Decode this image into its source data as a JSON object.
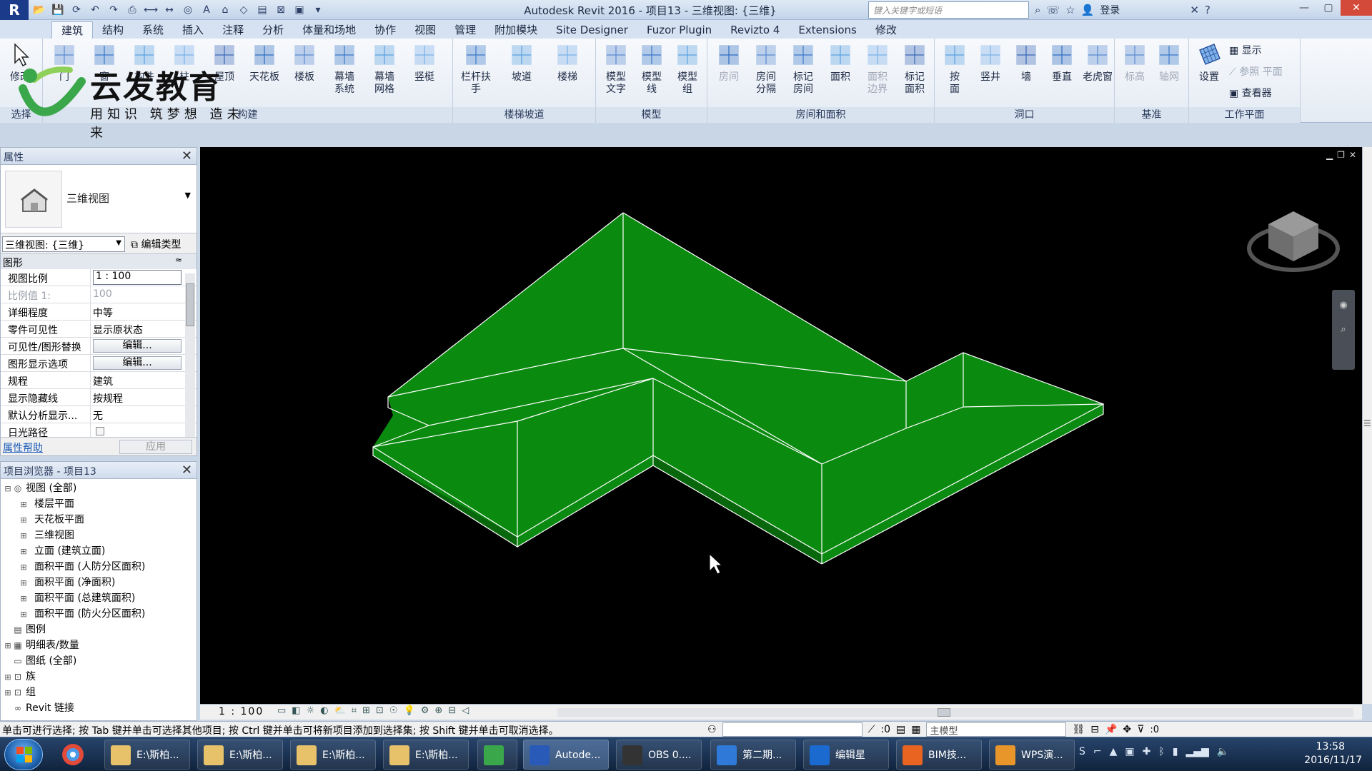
{
  "titlebar": {
    "app_logo": "R",
    "title": "Autodesk Revit 2016 -    项目13 - 三维视图: {三维}",
    "search_placeholder": "键入关键字或短语",
    "login": "登录"
  },
  "brand": {
    "title": "云发教育",
    "slogan": "用知识 筑梦想 造未来"
  },
  "ribbon_tabs": [
    {
      "label": "建筑",
      "active": true
    },
    {
      "label": "结构"
    },
    {
      "label": "系统"
    },
    {
      "label": "插入"
    },
    {
      "label": "注释"
    },
    {
      "label": "分析"
    },
    {
      "label": "体量和场地"
    },
    {
      "label": "协作"
    },
    {
      "label": "视图"
    },
    {
      "label": "管理"
    },
    {
      "label": "附加模块"
    },
    {
      "label": "Site Designer"
    },
    {
      "label": "Fuzor Plugin"
    },
    {
      "label": "Revizto 4"
    },
    {
      "label": "Extensions"
    },
    {
      "label": "修改"
    }
  ],
  "ribbon": {
    "select": {
      "modify": "修改",
      "title": "选择"
    },
    "build": {
      "title": "构建",
      "buttons": [
        "门",
        "窗",
        "构件",
        "柱",
        "屋顶",
        "天花板",
        "楼板",
        "幕墙\n系统",
        "幕墙\n网格",
        "竖梃"
      ]
    },
    "stairs": {
      "title": "楼梯坡道",
      "buttons": [
        "栏杆扶手",
        "坡道",
        "楼梯"
      ]
    },
    "model": {
      "title": "模型",
      "buttons": [
        "模型\n文字",
        "模型\n线",
        "模型\n组"
      ]
    },
    "room": {
      "title": "房间和面积",
      "buttons": [
        "房间",
        "房间\n分隔",
        "标记\n房间",
        "面积",
        "面积\n边界",
        "标记\n面积"
      ]
    },
    "opening": {
      "title": "洞口",
      "buttons": [
        "按\n面",
        "竖井",
        "墙",
        "垂直",
        "老虎窗"
      ]
    },
    "datum": {
      "title": "基准",
      "buttons": [
        "标高",
        "轴网"
      ]
    },
    "workplane": {
      "title": "工作平面",
      "set": "设置",
      "show": "显示",
      "ref_plane": "参照 平面",
      "viewer": "查看器"
    }
  },
  "properties": {
    "title": "属性",
    "type_name": "三维视图",
    "view_selector": "三维视图: {三维}",
    "edit_type": "编辑类型",
    "category": "图形",
    "rows": [
      {
        "key": "视图比例",
        "value": "1 : 100",
        "kind": "input"
      },
      {
        "key": "比例值 1:",
        "value": "100",
        "kind": "dim"
      },
      {
        "key": "详细程度",
        "value": "中等"
      },
      {
        "key": "零件可见性",
        "value": "显示原状态"
      },
      {
        "key": "可见性/图形替换",
        "value": "编辑...",
        "kind": "button"
      },
      {
        "key": "图形显示选项",
        "value": "编辑...",
        "kind": "button"
      },
      {
        "key": "规程",
        "value": "建筑"
      },
      {
        "key": "显示隐藏线",
        "value": "按规程"
      },
      {
        "key": "默认分析显示...",
        "value": "无"
      },
      {
        "key": "日光路径",
        "value": "",
        "kind": "checkbox"
      }
    ],
    "help": "属性帮助",
    "apply": "应用"
  },
  "browser": {
    "title": "项目浏览器 - 项目13",
    "nodes": [
      {
        "label": "视图 (全部)",
        "level": 0,
        "exp": "⊟",
        "icon": "◎"
      },
      {
        "label": "楼层平面",
        "level": 1,
        "exp": "⊞"
      },
      {
        "label": "天花板平面",
        "level": 1,
        "exp": "⊞"
      },
      {
        "label": "三维视图",
        "level": 1,
        "exp": "⊞"
      },
      {
        "label": "立面 (建筑立面)",
        "level": 1,
        "exp": "⊞"
      },
      {
        "label": "面积平面 (人防分区面积)",
        "level": 1,
        "exp": "⊞"
      },
      {
        "label": "面积平面 (净面积)",
        "level": 1,
        "exp": "⊞"
      },
      {
        "label": "面积平面 (总建筑面积)",
        "level": 1,
        "exp": "⊞"
      },
      {
        "label": "面积平面 (防火分区面积)",
        "level": 1,
        "exp": "⊞"
      },
      {
        "label": "图例",
        "level": 0,
        "exp": "",
        "icon": "▤"
      },
      {
        "label": "明细表/数量",
        "level": 0,
        "exp": "⊞",
        "icon": "▦"
      },
      {
        "label": "图纸 (全部)",
        "level": 0,
        "exp": "",
        "icon": "▭"
      },
      {
        "label": "族",
        "level": 0,
        "exp": "⊞",
        "icon": "⊡"
      },
      {
        "label": "组",
        "level": 0,
        "exp": "⊞",
        "icon": "⊡"
      },
      {
        "label": "Revit 链接",
        "level": 0,
        "exp": "",
        "icon": "∞"
      }
    ]
  },
  "viewport": {
    "roof_color": "#0b8a10",
    "edge_color": "#ffffff"
  },
  "view_control": {
    "scale": "1 : 100"
  },
  "status": {
    "message": "单击可进行选择; 按 Tab 键并单击可选择其他项目; 按 Ctrl 键并单击可将新项目添加到选择集; 按 Shift 键并单击可取消选择。",
    "worksets": ":0",
    "model": "主模型",
    "filter": ":0"
  },
  "taskbar": {
    "items": [
      {
        "label": "E:\\斯柏...",
        "color": "#e8c26a"
      },
      {
        "label": "E:\\斯柏...",
        "color": "#e8c26a"
      },
      {
        "label": "E:\\斯柏...",
        "color": "#e8c26a"
      },
      {
        "label": "E:\\斯柏...",
        "color": "#e8c26a"
      },
      {
        "label": "",
        "color": "#3aa84a"
      },
      {
        "label": "Autode...",
        "color": "#2a5ab8",
        "active": true
      },
      {
        "label": "OBS 0....",
        "color": "#333"
      },
      {
        "label": "第二期...",
        "color": "#2f7ad8"
      },
      {
        "label": "编辑星",
        "color": "#1a6ad0"
      },
      {
        "label": "BIM技...",
        "color": "#e86420"
      },
      {
        "label": "WPS演...",
        "color": "#e8962a"
      }
    ],
    "time": "13:58",
    "date": "2016/11/17"
  }
}
